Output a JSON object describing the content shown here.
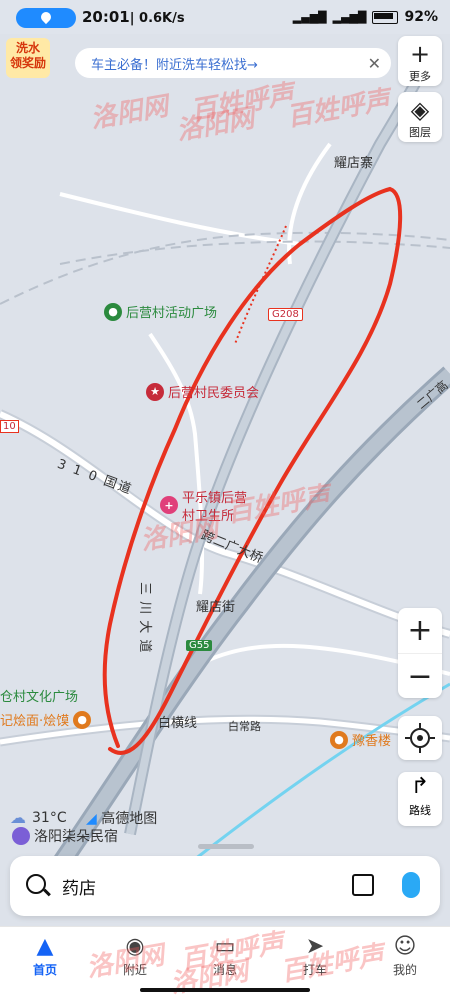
{
  "status_bar": {
    "time": "20:01",
    "speed": "| 0.6K/s",
    "battery_pct": "92%"
  },
  "promo": {
    "line1": "洗水",
    "line2": "领奖励"
  },
  "banner": {
    "text": "车主必备！附近洗车轻松找→"
  },
  "controls": {
    "more_label": "更多",
    "layers_label": "图层",
    "route_label": "路线",
    "zoom_in": "+",
    "zoom_out": "−"
  },
  "map": {
    "labels": {
      "yaodianzhai": "耀店寨",
      "road_g208": "G208",
      "road_310": "3 1 0 国道",
      "road_kuaer": "跨二广大桥",
      "road_sanchuan": "三 川 大 道",
      "yaodianjie": "耀店街",
      "road_g55": "G55",
      "baiheng": "白横线",
      "baichang": "白常路",
      "erguang": "二广高",
      "road_10": "10"
    },
    "pois": {
      "houying_square": "后营村活动广场",
      "houying_committee": "后营村民委员会",
      "clinic_line1": "平乐镇后营",
      "clinic_line2": "村卫生所",
      "culture_square": "仓村文化广场",
      "noodle": "记烩面·烩馍",
      "yuxiang": "豫香楼"
    },
    "colors": {
      "highway": "#9aa8b8",
      "road": "#ffffff",
      "annotation": "#e8321f",
      "background": "#dde2ea"
    }
  },
  "weather": {
    "temp": "31°C"
  },
  "brand": "高德地图",
  "homestay": "洛阳柒朵民宿",
  "search": {
    "value": "药店"
  },
  "tabs": [
    {
      "label": "首页",
      "icon": "home-icon",
      "active": true
    },
    {
      "label": "附近",
      "icon": "location-pin-icon",
      "active": false
    },
    {
      "label": "消息",
      "icon": "message-icon",
      "active": false
    },
    {
      "label": "打车",
      "icon": "taxi-icon",
      "active": false
    },
    {
      "label": "我的",
      "icon": "profile-icon",
      "active": false
    }
  ],
  "watermarks": {
    "text1": "洛阳网",
    "text2": "百姓呼声"
  }
}
